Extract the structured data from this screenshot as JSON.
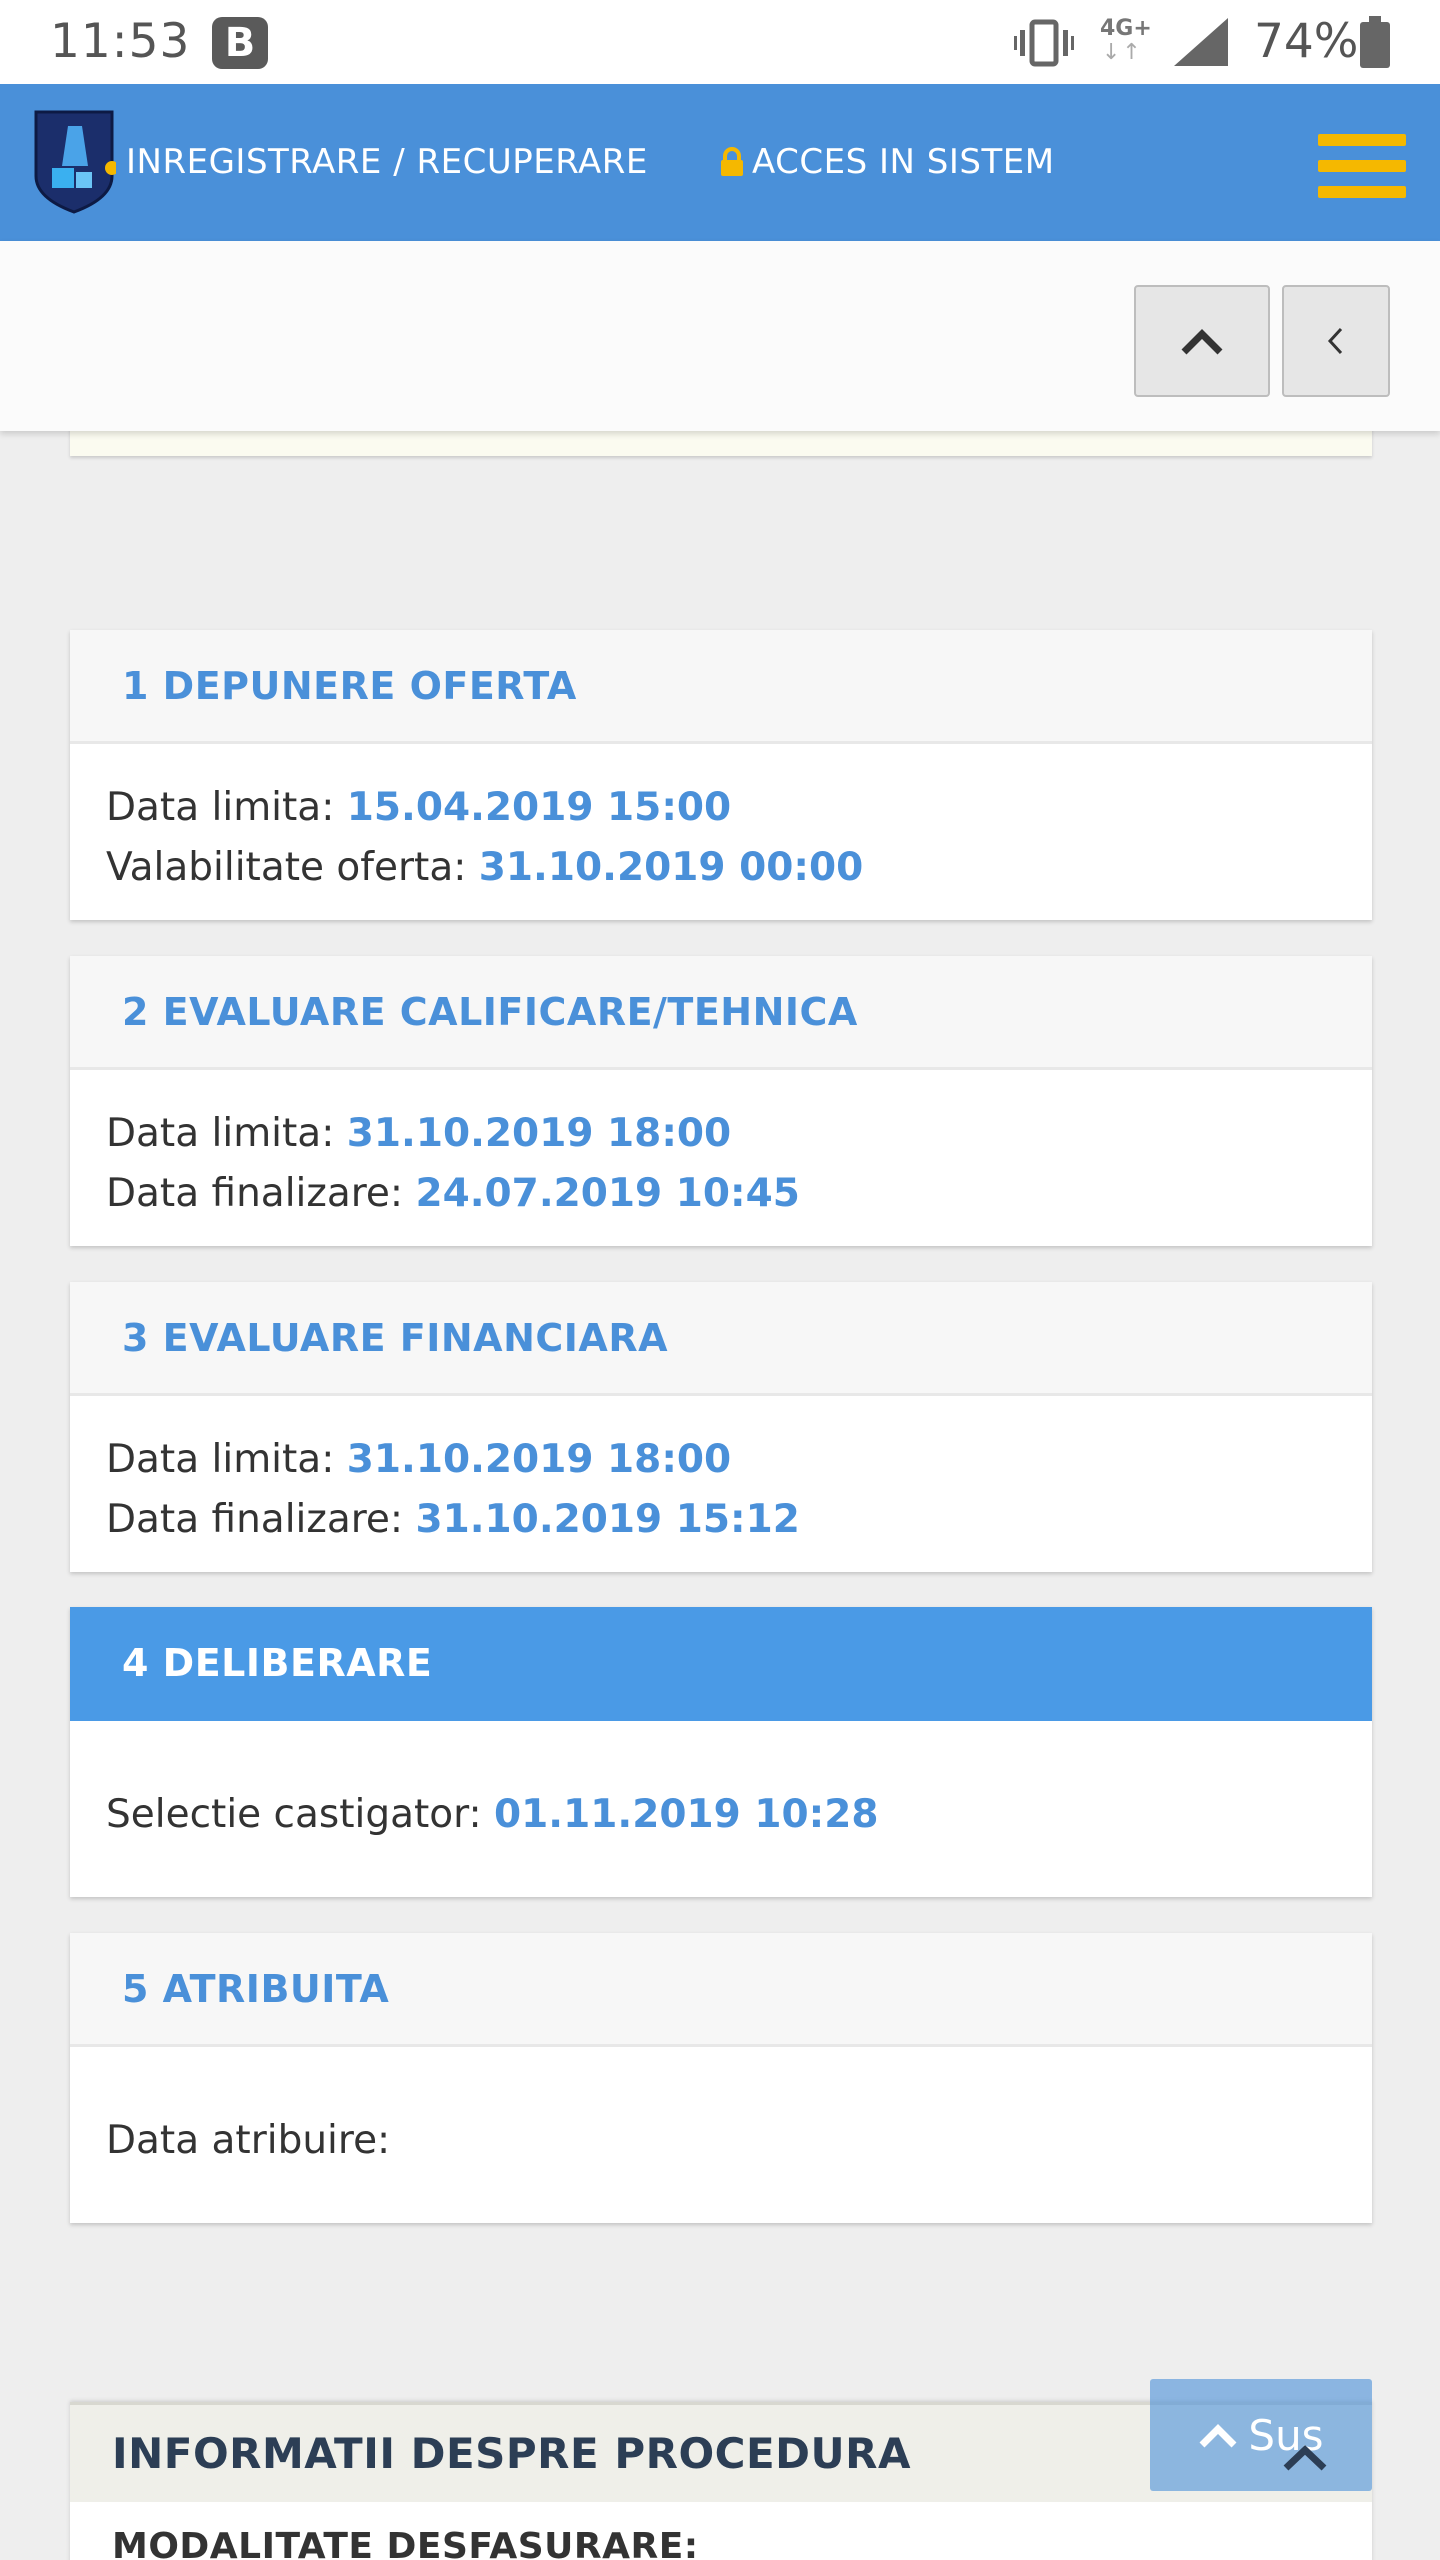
{
  "status_bar": {
    "time": "11:53",
    "app_badge": "B",
    "network": "4G+",
    "network_arrows": "↓↑",
    "battery": "74%"
  },
  "nav": {
    "register_label": "INREGISTRARE / RECUPERARE",
    "access_label": "ACCES IN SISTEM",
    "accent_color": "#f5b800",
    "bar_color": "#4a90d9"
  },
  "toolbar": {
    "up_icon": "chevron-up-icon",
    "back_icon": "chevron-left-icon"
  },
  "stages": [
    {
      "title": "1 DEPUNERE OFERTA",
      "active": false,
      "rows": [
        {
          "label": "Data limita: ",
          "value": "15.04.2019 15:00"
        },
        {
          "label": "Valabilitate oferta: ",
          "value": "31.10.2019 00:00"
        }
      ]
    },
    {
      "title": "2 EVALUARE CALIFICARE/TEHNICA",
      "active": false,
      "rows": [
        {
          "label": "Data limita: ",
          "value": "31.10.2019 18:00"
        },
        {
          "label": "Data finalizare: ",
          "value": "24.07.2019 10:45"
        }
      ]
    },
    {
      "title": "3 EVALUARE FINANCIARA",
      "active": false,
      "rows": [
        {
          "label": "Data limita: ",
          "value": "31.10.2019 18:00"
        },
        {
          "label": "Data finalizare: ",
          "value": "31.10.2019 15:12"
        }
      ]
    },
    {
      "title": "4 DELIBERARE",
      "active": true,
      "rows": [
        {
          "label": "Selectie castigator: ",
          "value": "01.11.2019 10:28"
        }
      ]
    },
    {
      "title": "5 ATRIBUITA",
      "active": false,
      "rows": [
        {
          "label": "Data atribuire: ",
          "value": ""
        }
      ]
    }
  ],
  "info": {
    "title": "INFORMATII DESPRE PROCEDURA",
    "subtitle": "MODALITATE DESFASURARE:"
  },
  "scroll_top": {
    "label": "Sus"
  }
}
